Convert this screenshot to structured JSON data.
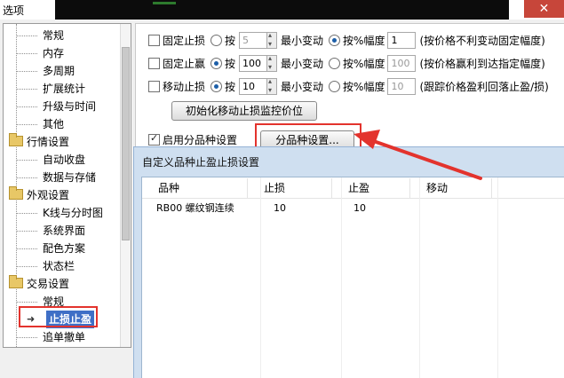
{
  "window": {
    "title": "选项",
    "close": "✕"
  },
  "tree": {
    "items": [
      {
        "label": "常规",
        "type": "child"
      },
      {
        "label": "内存",
        "type": "child"
      },
      {
        "label": "多周期",
        "type": "child"
      },
      {
        "label": "扩展统计",
        "type": "child"
      },
      {
        "label": "升级与时间",
        "type": "child"
      },
      {
        "label": "其他",
        "type": "child"
      },
      {
        "label": "行情设置",
        "type": "group"
      },
      {
        "label": "自动收盘",
        "type": "child"
      },
      {
        "label": "数据与存储",
        "type": "child"
      },
      {
        "label": "外观设置",
        "type": "group"
      },
      {
        "label": "K线与分时图",
        "type": "child"
      },
      {
        "label": "系统界面",
        "type": "child"
      },
      {
        "label": "配色方案",
        "type": "child"
      },
      {
        "label": "状态栏",
        "type": "child"
      },
      {
        "label": "交易设置",
        "type": "group"
      },
      {
        "label": "常规",
        "type": "child"
      },
      {
        "label": "止损止盈",
        "type": "selected"
      },
      {
        "label": "追单撤单",
        "type": "child"
      }
    ]
  },
  "stop": {
    "rows": [
      {
        "label": "固定止损",
        "checked": false,
        "by": "按",
        "value": "5",
        "value_gray": true,
        "min_label": "最小变动",
        "amp_label": "按%幅度",
        "amp_value": "1",
        "amp_gray": false,
        "note": "(按价格不利变动固定幅度)",
        "radio_by": false
      },
      {
        "label": "固定止赢",
        "checked": false,
        "by": "按",
        "value": "100",
        "value_gray": false,
        "min_label": "最小变动",
        "amp_label": "按%幅度",
        "amp_value": "100",
        "amp_gray": true,
        "note": "(按价格赢利到达指定幅度)",
        "radio_by": true
      },
      {
        "label": "移动止损",
        "checked": false,
        "by": "按",
        "value": "10",
        "value_gray": false,
        "min_label": "最小变动",
        "amp_label": "按%幅度",
        "amp_value": "10",
        "amp_gray": true,
        "note": "(跟踪价格盈利回落止盈/损)",
        "radio_by": true
      }
    ],
    "init_button": "初始化移动止损监控价位",
    "enable_label": "启用分品种设置",
    "variety_button": "分品种设置..."
  },
  "sub_dialog": {
    "title": "自定义品种止盈止损设置",
    "columns": [
      "品种",
      "止损",
      "止盈",
      "移动"
    ],
    "rows": [
      [
        "RB00 螺纹钢连续",
        "10",
        "10",
        ""
      ]
    ]
  },
  "colors": {
    "highlight": "#e3332d",
    "selection": "#3f6fc6",
    "sub_bg": "#cfdff0"
  }
}
